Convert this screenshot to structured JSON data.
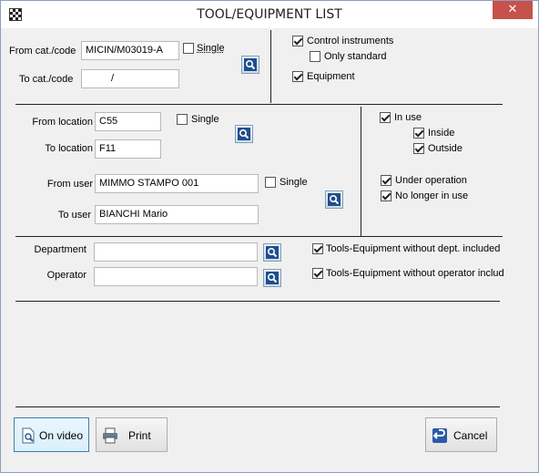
{
  "window": {
    "title": "TOOL/EQUIPMENT LIST",
    "close_glyph": "✕"
  },
  "catalog": {
    "from_label": "From cat./code",
    "from_value": "MICIN/M03019-A",
    "single_label": "Single",
    "single_checked": false,
    "to_label": "To cat./code",
    "to_value": "/"
  },
  "types": {
    "control_instruments": {
      "label": "Control instruments",
      "checked": true
    },
    "only_standard": {
      "label": "Only standard",
      "checked": false
    },
    "equipment": {
      "label": "Equipment",
      "checked": true
    }
  },
  "location": {
    "from_label": "From location",
    "from_value": "C55",
    "single_label": "Single",
    "single_checked": false,
    "to_label": "To location",
    "to_value": "F11"
  },
  "user": {
    "from_label": "From user",
    "from_value": "MIMMO STAMPO 001",
    "single_label": "Single",
    "single_checked": false,
    "to_label": "To user",
    "to_value": "BIANCHI Mario"
  },
  "status": {
    "in_use": {
      "label": "In use",
      "checked": true
    },
    "inside": {
      "label": "Inside",
      "checked": true
    },
    "outside": {
      "label": "Outside",
      "checked": true
    },
    "under_operation": {
      "label": "Under operation",
      "checked": true
    },
    "no_longer_in_use": {
      "label": "No longer in use",
      "checked": true
    }
  },
  "department": {
    "label": "Department",
    "value": "",
    "without_dept": {
      "label": "Tools-Equipment without dept. included",
      "checked": true
    }
  },
  "operator": {
    "label": "Operator",
    "value": "",
    "without_operator": {
      "label": "Tools-Equipment without operator included",
      "checked": true
    }
  },
  "buttons": {
    "on_video": "On video",
    "print": "Print",
    "cancel": "Cancel"
  },
  "icons": {
    "search": "magnifier-icon",
    "preview": "document-search-icon",
    "print": "printer-icon",
    "cancel": "undo-arrow-icon"
  },
  "colors": {
    "search_button": "#1f4e8c",
    "close_button": "#c7514b"
  }
}
